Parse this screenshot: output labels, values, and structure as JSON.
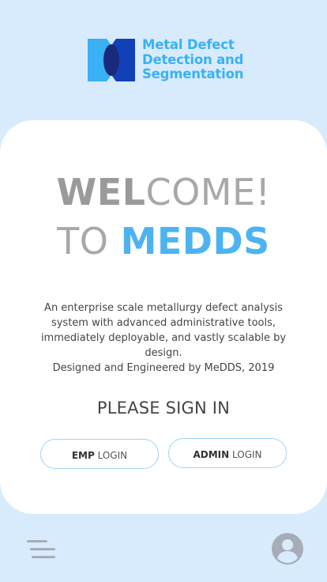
{
  "logo": {
    "line1": "Metal Defect",
    "line2": "Detection and",
    "line3": "Segmentation"
  },
  "welcome": {
    "line1_bold": "WEL",
    "line1_light": "COME!",
    "line2_light": "TO ",
    "line2_accent": "MEDDS"
  },
  "description": "An enterprise scale metallurgy defect analysis\nsystem with advanced administrative tools,\nimmediately deployable, and vastly scalable by design.\nDesigned and Engineered by MeDDS, 2019",
  "signin": {
    "heading": "PLEASE SIGN IN",
    "emp_strong": "EMP",
    "emp_rest": " LOGIN",
    "admin_strong": "ADMIN",
    "admin_rest": " LOGIN"
  },
  "icons": {
    "menu": "hamburger-menu-icon",
    "profile": "user-avatar-icon"
  },
  "colors": {
    "background": "#d7ebfc",
    "accent": "#4db3f0",
    "logo_dark": "#1240b8",
    "logo_light": "#3ab0f5",
    "button_border": "#9ed3f2",
    "icon": "#a6acb8"
  }
}
